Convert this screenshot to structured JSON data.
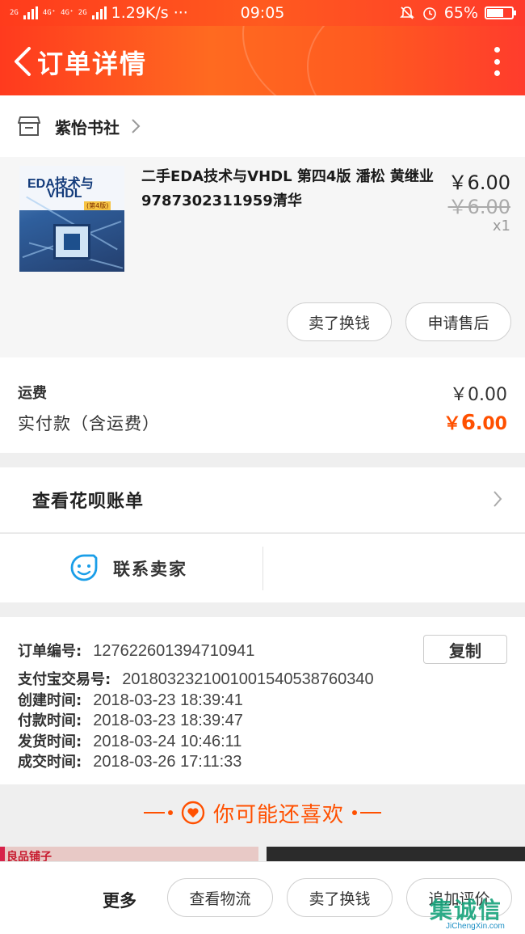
{
  "status_bar": {
    "signal_1": "2G",
    "signal_2": "4G⁺",
    "signal_3": "4G⁺ 2G",
    "speed": "1.29K/s",
    "dots": "···",
    "time": "09:05",
    "battery": "65%",
    "battery_level": 0.65
  },
  "header": {
    "title": "订单详情"
  },
  "shop": {
    "name": "紫怡书社"
  },
  "item": {
    "cover_title_1": "EDA技术与",
    "cover_title_2": "VHDL",
    "cover_edition": "(第4版)",
    "title": "二手EDA技术与VHDL 第四4版 潘松 黄继业 9787302311959清华",
    "price": "￥6.00",
    "original_price": "￥6.00",
    "quantity": "x1",
    "actions": [
      "卖了换钱",
      "申请售后"
    ]
  },
  "fees": {
    "shipping_label": "运费",
    "shipping_value": "￥0.00",
    "paid_label": "实付款（含运费）",
    "paid_currency": "￥",
    "paid_int": "6",
    "paid_dec": ".00"
  },
  "huabei": {
    "label": "查看花呗账单"
  },
  "contact": {
    "label": "联系卖家"
  },
  "order_info": {
    "copy_label": "复制",
    "rows": [
      {
        "label": "订单编号:",
        "value": "127622601394710941"
      },
      {
        "label": "支付宝交易号:",
        "value": "2018032321001001540538760340"
      },
      {
        "label": "创建时间:",
        "value": "2018-03-23 18:39:41"
      },
      {
        "label": "付款时间:",
        "value": "2018-03-23 18:39:47"
      },
      {
        "label": "发货时间:",
        "value": "2018-03-24 10:46:11"
      },
      {
        "label": "成交时间:",
        "value": "2018-03-26 17:11:33"
      }
    ]
  },
  "recommend": {
    "title": "你可能还喜欢",
    "peek_text": "良品铺子"
  },
  "bottom_bar": {
    "more_label": "更多",
    "buttons": [
      "查看物流",
      "卖了换钱",
      "追加评价"
    ]
  },
  "watermark": {
    "text": "集诚信",
    "sub": "JiChengXin.com"
  },
  "colors": {
    "accent": "#ff5000",
    "header_start": "#ff3a1e",
    "header_end": "#ff3c2c"
  }
}
